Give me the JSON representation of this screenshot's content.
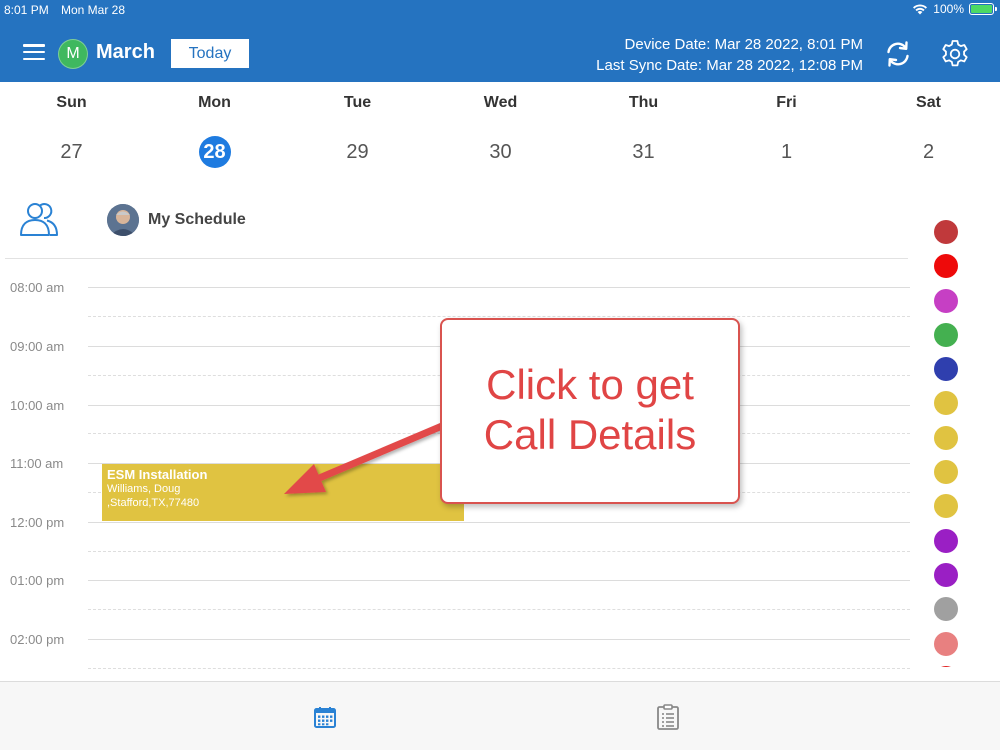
{
  "status_bar": {
    "time": "8:01 PM",
    "date": "Mon Mar 28",
    "battery": "100%"
  },
  "header": {
    "avatar_initial": "M",
    "month": "March",
    "today_label": "Today",
    "device_date": "Device Date: Mar 28 2022, 8:01 PM",
    "last_sync": "Last Sync Date: Mar 28 2022, 12:08 PM"
  },
  "week": {
    "days": [
      {
        "name": "Sun",
        "num": "27"
      },
      {
        "name": "Mon",
        "num": "28",
        "selected": true
      },
      {
        "name": "Tue",
        "num": "29"
      },
      {
        "name": "Wed",
        "num": "30"
      },
      {
        "name": "Thu",
        "num": "31"
      },
      {
        "name": "Fri",
        "num": "1"
      },
      {
        "name": "Sat",
        "num": "2"
      }
    ]
  },
  "schedule": {
    "label": "My Schedule"
  },
  "timeline": {
    "hours": [
      "08:00 am",
      "09:00 am",
      "10:00 am",
      "11:00 am",
      "12:00 pm",
      "01:00 pm",
      "02:00 pm"
    ]
  },
  "event": {
    "title": "ESM Installation",
    "name": "Williams, Doug",
    "address": ",Stafford,TX,77480",
    "color": "#e0c341"
  },
  "callout": {
    "line1": "Click to get",
    "line2": "Call Details"
  },
  "status_colors": [
    "#c0393b",
    "#ee0a0a",
    "#c63fc4",
    "#44b050",
    "#2f3fae",
    "#e0c341",
    "#e0c341",
    "#e0c341",
    "#e0c341",
    "#9a1fc4",
    "#9a1fc4",
    "#a0a0a0",
    "#e88080",
    "#e02020"
  ],
  "colors": {
    "header_bg": "#2573c0",
    "accent": "#1e7be0"
  },
  "icons": {
    "menu": "menu-icon",
    "sync": "sync-icon",
    "settings": "gear-icon",
    "people": "people-icon",
    "calendar": "calendar-icon",
    "list": "clipboard-list-icon"
  }
}
